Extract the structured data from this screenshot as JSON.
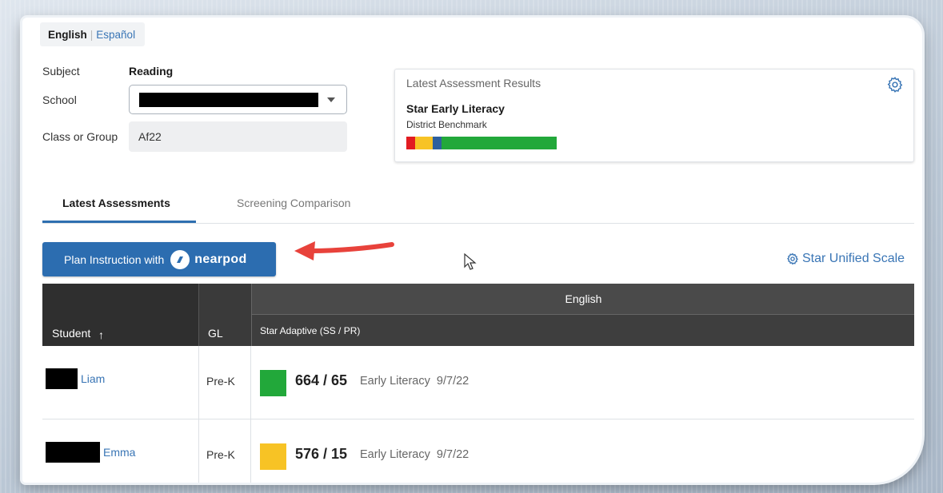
{
  "language": {
    "active": "English",
    "other": "Español",
    "separator": "|"
  },
  "filters": {
    "subject_label": "Subject",
    "subject_value": "Reading",
    "school_label": "School",
    "class_label": "Class or Group",
    "class_value": "Af22"
  },
  "results_card": {
    "title": "Latest Assessment Results",
    "assessment": "Star Early Literacy",
    "benchmark": "District Benchmark",
    "bar": [
      {
        "color": "#e21c21",
        "share": 0.057
      },
      {
        "color": "#f7c325",
        "share": 0.12
      },
      {
        "color": "#2e5f9e",
        "share": 0.057
      },
      {
        "color": "#22a83a",
        "share": 0.766
      }
    ]
  },
  "tabs": [
    {
      "label": "Latest Assessments",
      "active": true
    },
    {
      "label": "Screening Comparison",
      "active": false
    }
  ],
  "toolbar": {
    "plan_label": "Plan Instruction with",
    "plan_brand": "nearpod",
    "scale_label": "Star Unified Scale"
  },
  "table": {
    "col_student": "Student",
    "sort_indicator": "↑",
    "col_gl": "GL",
    "group_header": "English",
    "sub_header": "Star Adaptive (SS / PR)",
    "rows": [
      {
        "name": "Liam",
        "gl": "Pre-K",
        "score": "664 / 65",
        "test": "Early Literacy",
        "date": "9/7/22",
        "color": "#22a83a"
      },
      {
        "name": "Emma",
        "gl": "Pre-K",
        "score": "576 / 15",
        "test": "Early Literacy",
        "date": "9/7/22",
        "color": "#f7c325"
      }
    ]
  },
  "colors": {
    "accent": "#2c6db0",
    "link": "#3975b5",
    "arrow": "#e8423b"
  }
}
